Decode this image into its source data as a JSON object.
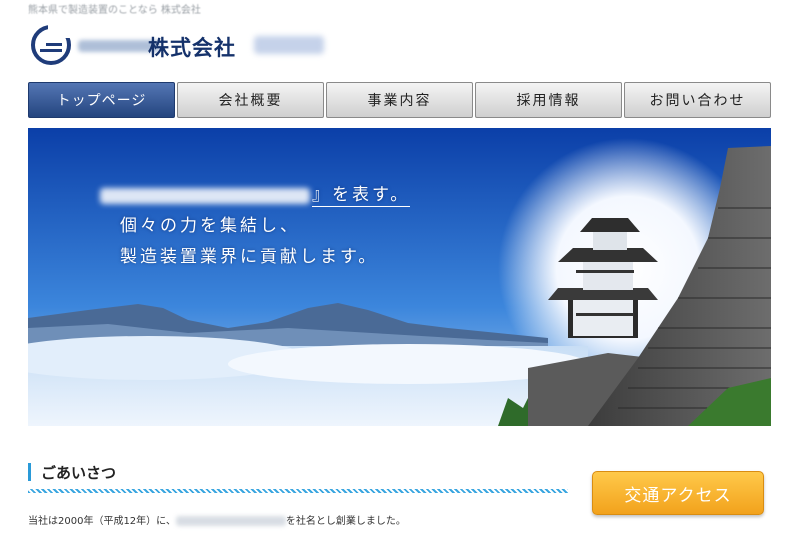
{
  "header": {
    "tagline": "熊本県で製造装置のことなら 株式会社",
    "company_name": "株式会社"
  },
  "nav": {
    "items": [
      {
        "label": "トップページ",
        "active": true
      },
      {
        "label": "会社概要",
        "active": false
      },
      {
        "label": "事業内容",
        "active": false
      },
      {
        "label": "採用情報",
        "active": false
      },
      {
        "label": "お問い合わせ",
        "active": false
      }
    ]
  },
  "hero": {
    "line1_suffix": "』を表す。",
    "line2": "個々の力を集結し、",
    "line3": "製造装置業界に貢献します。"
  },
  "greeting": {
    "title": "ごあいさつ",
    "body_prefix": "当社は2000年（平成12年）に、",
    "body_suffix": "を社名とし創業しました。"
  },
  "access_button": {
    "label": "交通アクセス"
  },
  "colors": {
    "brand_navy": "#15326b",
    "nav_active": "#2d4f8c",
    "accent_blue": "#2a9ad8",
    "button_orange": "#f5ac26"
  }
}
